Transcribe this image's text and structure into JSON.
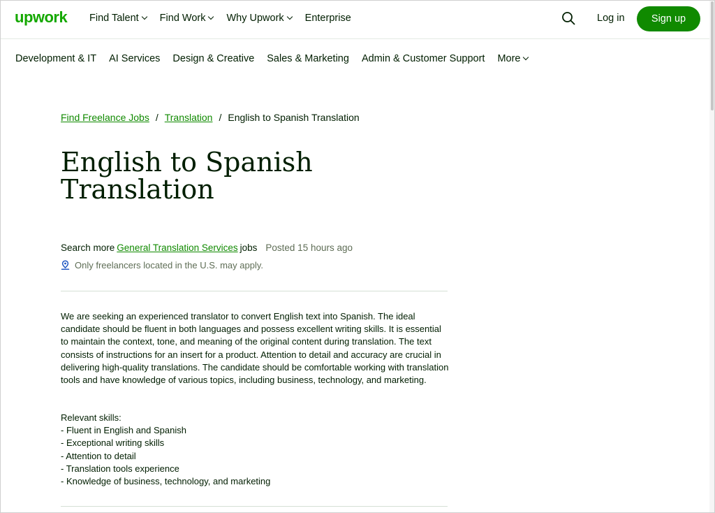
{
  "header": {
    "logo": "upwork",
    "nav": [
      {
        "label": "Find Talent"
      },
      {
        "label": "Find Work"
      },
      {
        "label": "Why Upwork"
      },
      {
        "label": "Enterprise"
      }
    ],
    "login_label": "Log in",
    "signup_label": "Sign up"
  },
  "categories": [
    {
      "label": "Development & IT"
    },
    {
      "label": "AI Services"
    },
    {
      "label": "Design & Creative"
    },
    {
      "label": "Sales & Marketing"
    },
    {
      "label": "Admin & Customer Support"
    },
    {
      "label": "More"
    }
  ],
  "breadcrumb": {
    "items": [
      "Find Freelance Jobs",
      "Translation"
    ],
    "separator": "/",
    "current": "English to Spanish Translation"
  },
  "job": {
    "title_line1": "English to Spanish",
    "title_line2": "Translation",
    "search_prefix": "Search more",
    "category_link": "General Translation Services",
    "search_suffix": "jobs",
    "posted": "Posted 15 hours ago",
    "location_note": "Only freelancers located in the U.S. may apply.",
    "description": "We are seeking an experienced translator to convert English text into Spanish. The ideal candidate should be fluent in both languages and possess excellent writing skills. It is essential to maintain the context, tone, and meaning of the original content during translation. The text consists of instructions for an insert for a product. Attention to detail and accuracy are crucial in delivering high-quality translations. The candidate should be comfortable working with translation tools and have knowledge of various topics, including business, technology, and marketing.",
    "skills_heading": "Relevant skills:",
    "skills": [
      "- Fluent in English and Spanish",
      "- Exceptional writing skills",
      "- Attention to detail",
      "- Translation tools experience",
      "- Knowledge of business, technology, and marketing"
    ]
  },
  "colors": {
    "brand": "#14a800",
    "button": "#108a00",
    "text": "#001e00",
    "muted": "#5e6d55"
  }
}
